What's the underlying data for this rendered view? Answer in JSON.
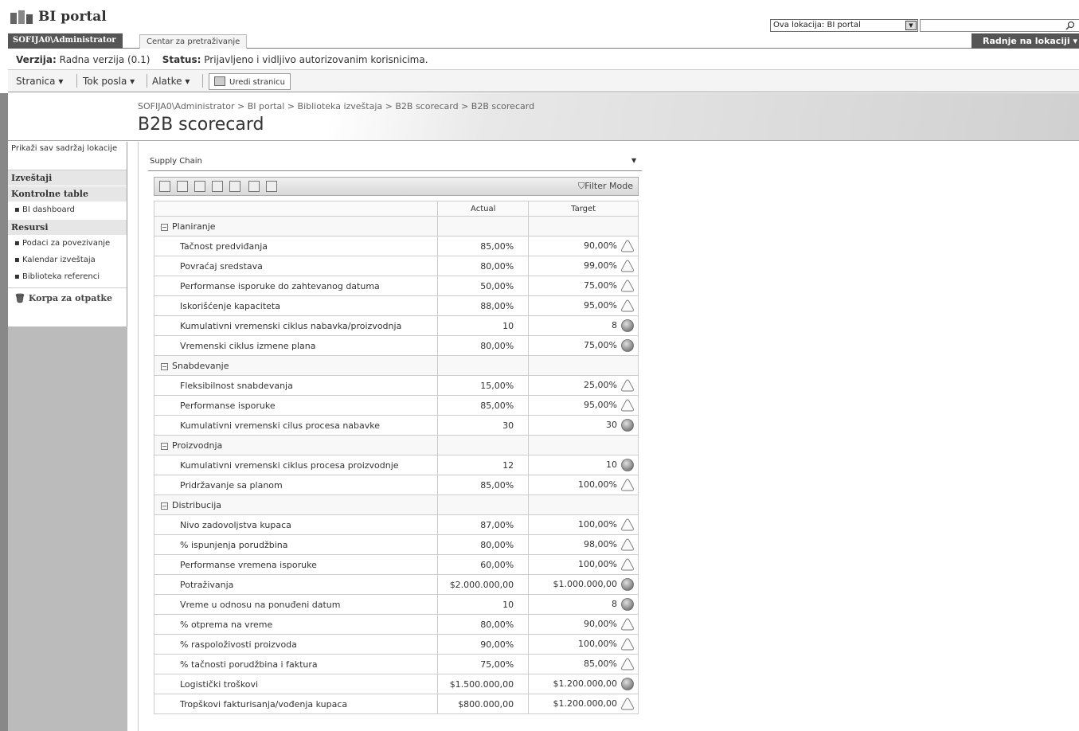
{
  "site": {
    "title": "BI portal"
  },
  "search": {
    "scope": "Ova lokacija: BI portal"
  },
  "tabs": {
    "user": "SOFIJA0\\Administrator",
    "search_center": "Centar za pretraživanje",
    "site_actions": "Radnje na lokaciji"
  },
  "status": {
    "version_label": "Verzija:",
    "version_value": "Radna verzija (0.1)",
    "status_label": "Status:",
    "status_value": "Prijavljeno i vidljivo autorizovanim korisnicima."
  },
  "toolbar": {
    "page": "Stranica",
    "workflow": "Tok posla",
    "tools": "Alatke",
    "edit_page": "Uredi stranicu"
  },
  "breadcrumb": "SOFIJA0\\Administrator > BI portal > Biblioteka izveštaja > B2B scorecard > B2B scorecard",
  "page_title": "B2B scorecard",
  "nav": {
    "view_all": "Prikaži sav sadržaj lokacije",
    "reports": "Izveštaji",
    "dashboards": "Kontrolne table",
    "bi_dashboard": "BI dashboard",
    "resources": "Resursi",
    "data_connections": "Podaci za povezivanje",
    "report_calendar": "Kalendar izveštaja",
    "reference_library": "Biblioteka referenci",
    "recycle_bin": "Korpa za otpatke"
  },
  "webpart": {
    "title": "Supply Chain",
    "filter_mode": "Filter Mode"
  },
  "scorecard": {
    "col_actual": "Actual",
    "col_target": "Target",
    "rows": [
      {
        "type": "group",
        "name": "Planiranje"
      },
      {
        "type": "kpi",
        "name": "Tačnost predviđanja",
        "actual": "85,00%",
        "target": "90,00%",
        "indicator": "triangle"
      },
      {
        "type": "kpi",
        "name": "Povraćaj sredstava",
        "actual": "80,00%",
        "target": "99,00%",
        "indicator": "triangle"
      },
      {
        "type": "kpi",
        "name": "Performanse isporuke do zahtevanog datuma",
        "actual": "50,00%",
        "target": "75,00%",
        "indicator": "triangle"
      },
      {
        "type": "kpi",
        "name": "Iskorišćenje kapaciteta",
        "actual": "88,00%",
        "target": "95,00%",
        "indicator": "triangle"
      },
      {
        "type": "kpi",
        "name": "Kumulativni vremenski ciklus nabavka/proizvodnja",
        "actual": "10",
        "target": "8",
        "indicator": "circle"
      },
      {
        "type": "kpi",
        "name": "Vremenski ciklus izmene plana",
        "actual": "80,00%",
        "target": "75,00%",
        "indicator": "circle"
      },
      {
        "type": "group",
        "name": "Snabdevanje"
      },
      {
        "type": "kpi",
        "name": "Fleksibilnost snabdevanja",
        "actual": "15,00%",
        "target": "25,00%",
        "indicator": "triangle"
      },
      {
        "type": "kpi",
        "name": "Performanse isporuke",
        "actual": "85,00%",
        "target": "95,00%",
        "indicator": "triangle"
      },
      {
        "type": "kpi",
        "name": "Kumulativni vremenski cilus procesa nabavke",
        "actual": "30",
        "target": "30",
        "indicator": "circle"
      },
      {
        "type": "group",
        "name": "Proizvodnja"
      },
      {
        "type": "kpi",
        "name": "Kumulativni vremenski ciklus procesa proizvodnje",
        "actual": "12",
        "target": "10",
        "indicator": "circle"
      },
      {
        "type": "kpi",
        "name": "Pridržavanje sa planom",
        "actual": "85,00%",
        "target": "100,00%",
        "indicator": "triangle"
      },
      {
        "type": "group",
        "name": "Distribucija"
      },
      {
        "type": "kpi",
        "name": "Nivo zadovoljstva kupaca",
        "actual": "87,00%",
        "target": "100,00%",
        "indicator": "triangle"
      },
      {
        "type": "kpi",
        "name": "% ispunjenja porudžbina",
        "actual": "80,00%",
        "target": "98,00%",
        "indicator": "triangle"
      },
      {
        "type": "kpi",
        "name": "Performanse vremena isporuke",
        "actual": "60,00%",
        "target": "100,00%",
        "indicator": "triangle"
      },
      {
        "type": "kpi",
        "name": "Potraživanja",
        "actual": "$2.000.000,00",
        "target": "$1.000.000,00",
        "indicator": "circle"
      },
      {
        "type": "kpi",
        "name": "Vreme u odnosu na ponuđeni datum",
        "actual": "10",
        "target": "8",
        "indicator": "circle"
      },
      {
        "type": "kpi",
        "name": "% otprema na vreme",
        "actual": "80,00%",
        "target": "90,00%",
        "indicator": "triangle"
      },
      {
        "type": "kpi",
        "name": "% raspoloživosti proizvoda",
        "actual": "90,00%",
        "target": "100,00%",
        "indicator": "triangle"
      },
      {
        "type": "kpi",
        "name": "% tačnosti porudžbina i faktura",
        "actual": "75,00%",
        "target": "85,00%",
        "indicator": "triangle"
      },
      {
        "type": "kpi",
        "name": "Logistički troškovi",
        "actual": "$1.500.000,00",
        "target": "$1.200.000,00",
        "indicator": "circle"
      },
      {
        "type": "kpi",
        "name": "Tropškovi fakturisanja/vođenja kupaca",
        "actual": "$800.000,00",
        "target": "$1.200.000,00",
        "indicator": "triangle"
      }
    ]
  }
}
